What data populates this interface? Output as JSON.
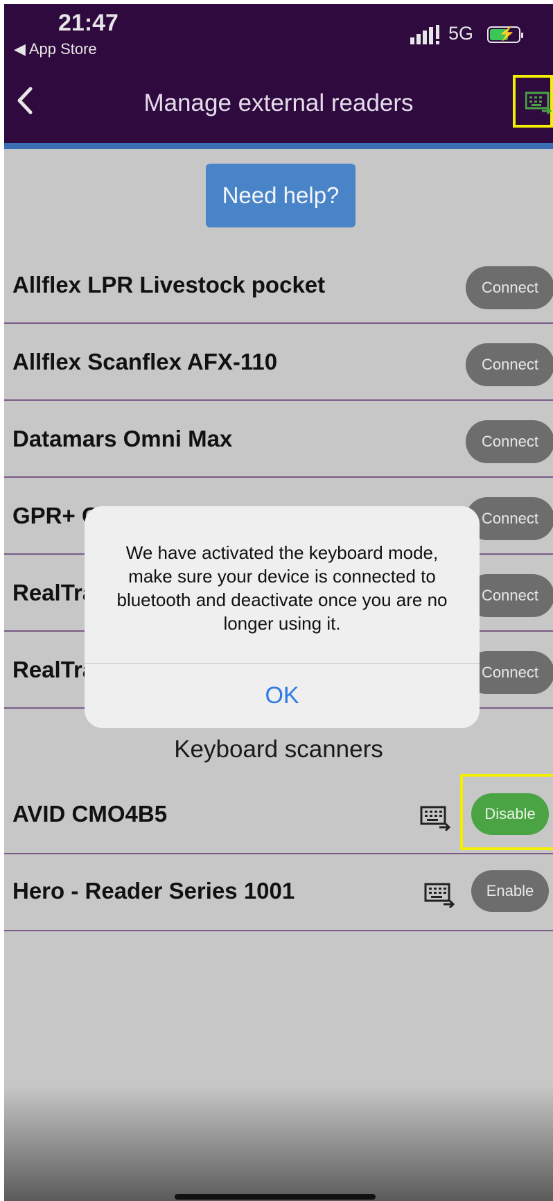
{
  "status_bar": {
    "time": "21:47",
    "back_app": "◀ App Store",
    "network": "5G"
  },
  "nav": {
    "title": "Manage external readers"
  },
  "help": {
    "label": "Need help?"
  },
  "readers": [
    {
      "name": "Allflex LPR Livestock pocket",
      "action": "Connect"
    },
    {
      "name": "Allflex Scanflex AFX-110",
      "action": "Connect"
    },
    {
      "name": "Datamars Omni Max",
      "action": "Connect"
    },
    {
      "name": "GPR+ Global Pocket Reader Plus",
      "action": "Connect"
    },
    {
      "name": "RealTrace",
      "action": "Connect"
    },
    {
      "name": "RealTrace",
      "action": "Connect"
    }
  ],
  "keyboard_section": {
    "title": "Keyboard scanners"
  },
  "keyboard_scanners": [
    {
      "name": "AVID CMO4B5",
      "action": "Disable",
      "active": true
    },
    {
      "name": "Hero - Reader Series 1001",
      "action": "Enable",
      "active": false
    }
  ],
  "alert": {
    "message": "We have activated the keyboard mode, make sure your device is connected to bluetooth and deactivate once you are no longer using it.",
    "ok_label": "OK"
  },
  "colors": {
    "header": "#2e0a3f",
    "help": "#4a84c8",
    "enabled": "#4aa443",
    "highlight": "#f3ef00",
    "link": "#2f7ae5"
  }
}
